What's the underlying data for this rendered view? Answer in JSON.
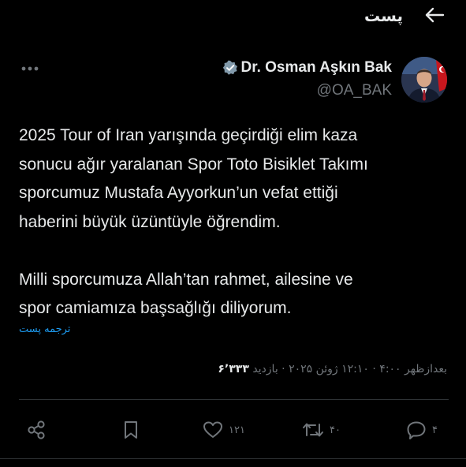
{
  "header": {
    "title": "پست",
    "back_icon": "arrow-left-icon"
  },
  "author": {
    "name": "Dr. Osman Aşkın Bak",
    "handle": "@OA_BAK",
    "verified_icon": "verified-badge-icon",
    "verified_color": "#829aab",
    "avatar_icon": "profile-photo"
  },
  "tweet": {
    "paragraphs": [
      "2025 Tour of Iran yarışında geçirdiği elim kaza\nsonucu ağır yaralanan Spor Toto Bisiklet Takımı\nsporcumuz Mustafa Ayyorkun’un vefat ettiği\nhaberini büyük üzüntüyle öğrendim.",
      "Milli sporcumuza Allah’tan rahmet, ailesine ve\nspor camiamıza başsağlığı diliyorum."
    ],
    "translate_label": "ترجمه پست"
  },
  "meta": {
    "time": "بعدازظهر ۴:۰۰",
    "sep1": " · ",
    "date": "۱۲:۱۰ ژوئن ۲۰۲۵",
    "sep2": " · ",
    "views_label": "بازدید",
    "views_count": "۶٬۳۳۳"
  },
  "actions": {
    "reply_count": "۴",
    "retweet_count": "۴۰",
    "like_count": "۱۲۱",
    "bookmark_icon": "bookmark-icon",
    "share_icon": "share-icon"
  },
  "colors": {
    "background": "#000000",
    "text": "#e7e9ea",
    "muted": "#71767b",
    "link": "#1d9bf0",
    "divider": "#2f3336"
  }
}
